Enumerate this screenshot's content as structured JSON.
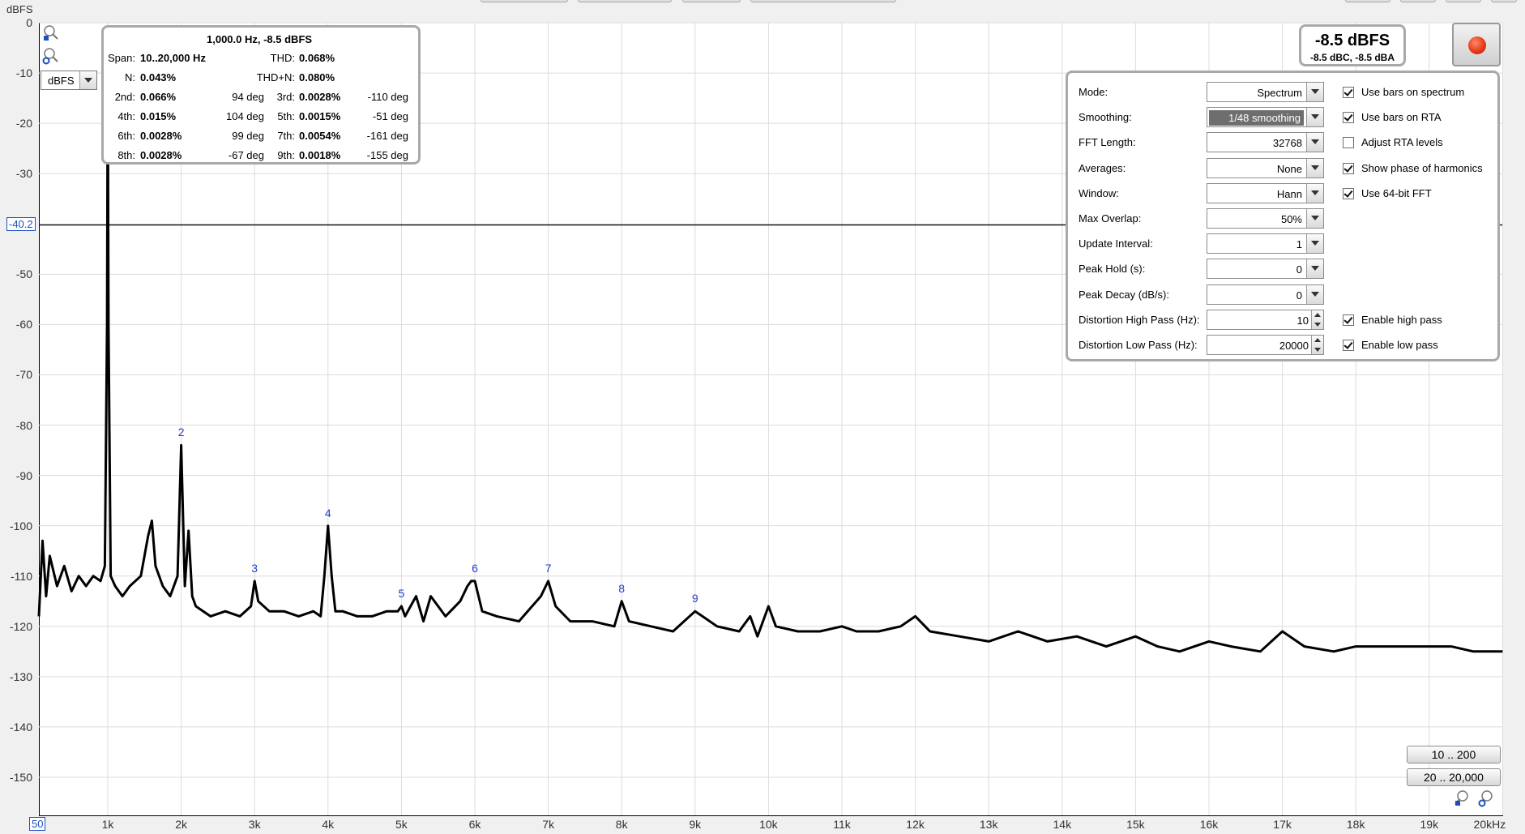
{
  "yaxis": {
    "unit": "dBFS",
    "ticks": [
      "0",
      "-10",
      "-20",
      "-30",
      "-40.2",
      "-50",
      "-60",
      "-70",
      "-80",
      "-90",
      "-100",
      "-110",
      "-120",
      "-130",
      "-140",
      "-150"
    ],
    "cursor_level": "-40.2"
  },
  "xaxis": {
    "start": "50",
    "ticks": [
      "1k",
      "2k",
      "3k",
      "4k",
      "5k",
      "6k",
      "7k",
      "8k",
      "9k",
      "10k",
      "11k",
      "12k",
      "13k",
      "14k",
      "15k",
      "16k",
      "17k",
      "18k",
      "19k",
      "20kHz"
    ]
  },
  "unit_select": {
    "value": "dBFS"
  },
  "info": {
    "header": "1,000.0 Hz, -8.5 dBFS",
    "span_label": "Span:",
    "span_value": "10..20,000 Hz",
    "thd_label": "THD:",
    "thd_value": "0.068%",
    "n_label": "N:",
    "n_value": "0.043%",
    "thdn_label": "THD+N:",
    "thdn_value": "0.080%",
    "harmonics": [
      {
        "label": "2nd:",
        "value": "0.066%",
        "phase": "94 deg",
        "label2": "3rd:",
        "value2": "0.0028%",
        "phase2": "-110 deg"
      },
      {
        "label": "4th:",
        "value": "0.015%",
        "phase": "104 deg",
        "label2": "5th:",
        "value2": "0.0015%",
        "phase2": "-51 deg"
      },
      {
        "label": "6th:",
        "value": "0.0028%",
        "phase": "99 deg",
        "label2": "7th:",
        "value2": "0.0054%",
        "phase2": "-161 deg"
      },
      {
        "label": "8th:",
        "value": "0.0028%",
        "phase": "-67 deg",
        "label2": "9th:",
        "value2": "0.0018%",
        "phase2": "-155 deg"
      }
    ]
  },
  "level": {
    "main": "-8.5 dBFS",
    "sub": "-8.5 dBC, -8.5 dBA"
  },
  "settings": {
    "rows": [
      {
        "label": "Mode:",
        "value": "Spectrum"
      },
      {
        "label": "Smoothing:",
        "value": "1/48 smoothing"
      },
      {
        "label": "FFT Length:",
        "value": "32768"
      },
      {
        "label": "Averages:",
        "value": "None"
      },
      {
        "label": "Window:",
        "value": "Hann"
      },
      {
        "label": "Max Overlap:",
        "value": "50%"
      },
      {
        "label": "Update Interval:",
        "value": "1"
      },
      {
        "label": "Peak Hold (s):",
        "value": "0"
      },
      {
        "label": "Peak Decay (dB/s):",
        "value": "0"
      },
      {
        "label": "Distortion High Pass (Hz):",
        "value": "10"
      },
      {
        "label": "Distortion Low Pass (Hz):",
        "value": "20000"
      }
    ],
    "checks": [
      {
        "label": "Use bars on spectrum",
        "checked": true
      },
      {
        "label": "Use bars on RTA",
        "checked": true
      },
      {
        "label": "Adjust RTA levels",
        "checked": false
      },
      {
        "label": "Show phase of harmonics",
        "checked": true
      },
      {
        "label": "Use 64-bit FFT",
        "checked": true
      },
      {
        "label": "Enable high pass",
        "checked": true
      },
      {
        "label": "Enable low pass",
        "checked": true
      }
    ]
  },
  "range_buttons": [
    "10 .. 200",
    "20 .. 20,000"
  ],
  "harmonic_markers": [
    "2",
    "3",
    "4",
    "5",
    "6",
    "7",
    "8",
    "9"
  ],
  "chart_data": {
    "type": "line",
    "ylabel": "dBFS",
    "xlabel": "",
    "xlim": [
      50,
      20000
    ],
    "ylim": [
      -160,
      0
    ],
    "grid": true,
    "cursor_line_db": -40.2,
    "series": [
      {
        "x": [
          50,
          100,
          150,
          200,
          300,
          400,
          500,
          600,
          700,
          800,
          900,
          960,
          990,
          1000,
          1010,
          1040,
          1100,
          1200,
          1300,
          1450,
          1550,
          1600,
          1650,
          1750,
          1850,
          1950,
          2000,
          2050,
          2100,
          2150,
          2200,
          2300,
          2400,
          2600,
          2800,
          2950,
          3000,
          3050,
          3200,
          3400,
          3600,
          3800,
          3900,
          3950,
          4000,
          4050,
          4100,
          4200,
          4400,
          4600,
          4800,
          4950,
          5000,
          5050,
          5200,
          5300,
          5400,
          5600,
          5800,
          5900,
          5950,
          6000,
          6100,
          6300,
          6600,
          6900,
          7000,
          7100,
          7300,
          7600,
          7900,
          8000,
          8100,
          8400,
          8700,
          9000,
          9100,
          9300,
          9600,
          9750,
          9850,
          10000,
          10100,
          10400,
          10700,
          11000,
          11200,
          11500,
          11800,
          12000,
          12200,
          12600,
          13000,
          13400,
          13800,
          14200,
          14600,
          15000,
          15300,
          15600,
          16000,
          16300,
          16700,
          17000,
          17300,
          17700,
          18000,
          18400,
          18700,
          19000,
          19300,
          19600,
          20000
        ],
        "y": [
          -118,
          -103,
          -114,
          -106,
          -112,
          -108,
          -113,
          -110,
          -112,
          -110,
          -111,
          -108,
          -60,
          -8.5,
          -60,
          -110,
          -112,
          -114,
          -112,
          -110,
          -102,
          -99,
          -108,
          -112,
          -114,
          -110,
          -84,
          -112,
          -101,
          -114,
          -116,
          -117,
          -118,
          -117,
          -118,
          -116,
          -111,
          -115,
          -117,
          -117,
          -118,
          -117,
          -118,
          -110,
          -100,
          -110,
          -117,
          -117,
          -118,
          -118,
          -117,
          -117,
          -116,
          -118,
          -114,
          -119,
          -114,
          -118,
          -115,
          -112,
          -111,
          -111,
          -117,
          -118,
          -119,
          -114,
          -111,
          -116,
          -119,
          -119,
          -120,
          -115,
          -119,
          -120,
          -121,
          -117,
          -118,
          -120,
          -121,
          -118,
          -122,
          -116,
          -120,
          -121,
          -121,
          -120,
          -121,
          -121,
          -120,
          -118,
          -121,
          -122,
          -123,
          -121,
          -123,
          -122,
          -124,
          -122,
          -124,
          -125,
          -123,
          -124,
          -125,
          -121,
          -124,
          -125,
          -124,
          -124,
          -124,
          -124,
          -124,
          -125,
          -125
        ]
      }
    ]
  }
}
